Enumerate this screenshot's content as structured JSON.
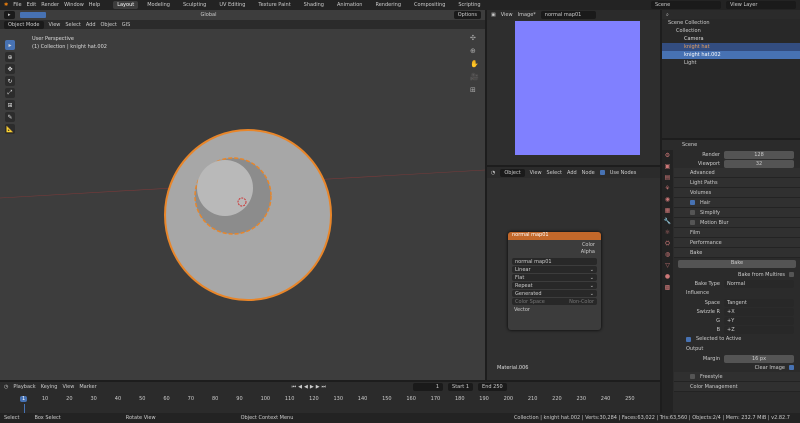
{
  "menu": [
    "File",
    "Edit",
    "Render",
    "Window",
    "Help"
  ],
  "workspaces": [
    "Layout",
    "Modeling",
    "Sculpting",
    "UV Editing",
    "Texture Paint",
    "Shading",
    "Animation",
    "Rendering",
    "Compositing",
    "Scripting"
  ],
  "scene": "Scene",
  "view_layer": "View Layer",
  "viewport": {
    "transform": "Global",
    "options": "Options",
    "mode": "Object Mode",
    "menus": [
      "View",
      "Select",
      "Add",
      "Object",
      "GIS"
    ],
    "title": "User Perspective",
    "subtitle": "(1) Collection | knight hat.002"
  },
  "image_editor": {
    "menus": [
      "View",
      "Image*"
    ],
    "image": "normal map01",
    "image_color": "#8080ff"
  },
  "node_editor": {
    "type": "Object",
    "menus": [
      "View",
      "Select",
      "Add",
      "Node"
    ],
    "use_nodes": "Use Nodes",
    "material": "Material.006",
    "node": {
      "title": "normal map01",
      "out_color": "Color",
      "out_alpha": "Alpha",
      "image": "normal map01",
      "interp": "Linear",
      "proj": "Flat",
      "ext": "Repeat",
      "source": "Generated",
      "colorspace_label": "Color Space",
      "colorspace": "Non-Color",
      "input": "Vector"
    }
  },
  "outliner": {
    "root": "Scene Collection",
    "items": [
      {
        "name": "Collection"
      },
      {
        "name": "Camera"
      },
      {
        "name": "knight hat"
      },
      {
        "name": "knight hat.002"
      },
      {
        "name": "Light"
      }
    ]
  },
  "properties": {
    "scene": "Scene",
    "render_label": "Render",
    "render": "128",
    "viewport_label": "Viewport",
    "viewport": "32",
    "panels": [
      "Advanced",
      "Light Paths",
      "Volumes",
      "Hair",
      "Simplify",
      "Motion Blur",
      "Film",
      "Performance",
      "Bake"
    ],
    "bake_button": "Bake",
    "bake_multires": "Bake from Multires",
    "bake_type_label": "Bake Type",
    "bake_type": "Normal",
    "influence": "Influence",
    "space_label": "Space",
    "space": "Tangent",
    "swizzle_r_label": "Swizzle R",
    "swizzle_r": "+X",
    "g_label": "G",
    "g": "+Y",
    "b_label": "B",
    "b": "+Z",
    "selected_to_active": "Selected to Active",
    "output": "Output",
    "margin_label": "Margin",
    "margin": "16 px",
    "clear_image": "Clear Image",
    "freestyle": "Freestyle",
    "color_management": "Color Management"
  },
  "timeline": {
    "menus": [
      "Playback",
      "Keying",
      "View",
      "Marker"
    ],
    "current": "1",
    "start_label": "Start",
    "start": "1",
    "end_label": "End",
    "end": "250",
    "ticks": [
      "1",
      "10",
      "20",
      "30",
      "40",
      "50",
      "60",
      "70",
      "80",
      "90",
      "100",
      "110",
      "120",
      "130",
      "140",
      "150",
      "160",
      "170",
      "180",
      "190",
      "200",
      "210",
      "220",
      "230",
      "240",
      "250"
    ]
  },
  "status": {
    "select": "Select",
    "box_select": "Box Select",
    "rotate": "Rotate View",
    "context": "Object Context Menu",
    "info": "Collection | knight hat.002 | Verts:30,284 | Faces:63,022 | Tris:63,560 | Objects:2/4 | Mem: 232.7 MiB | v2.82.7"
  }
}
